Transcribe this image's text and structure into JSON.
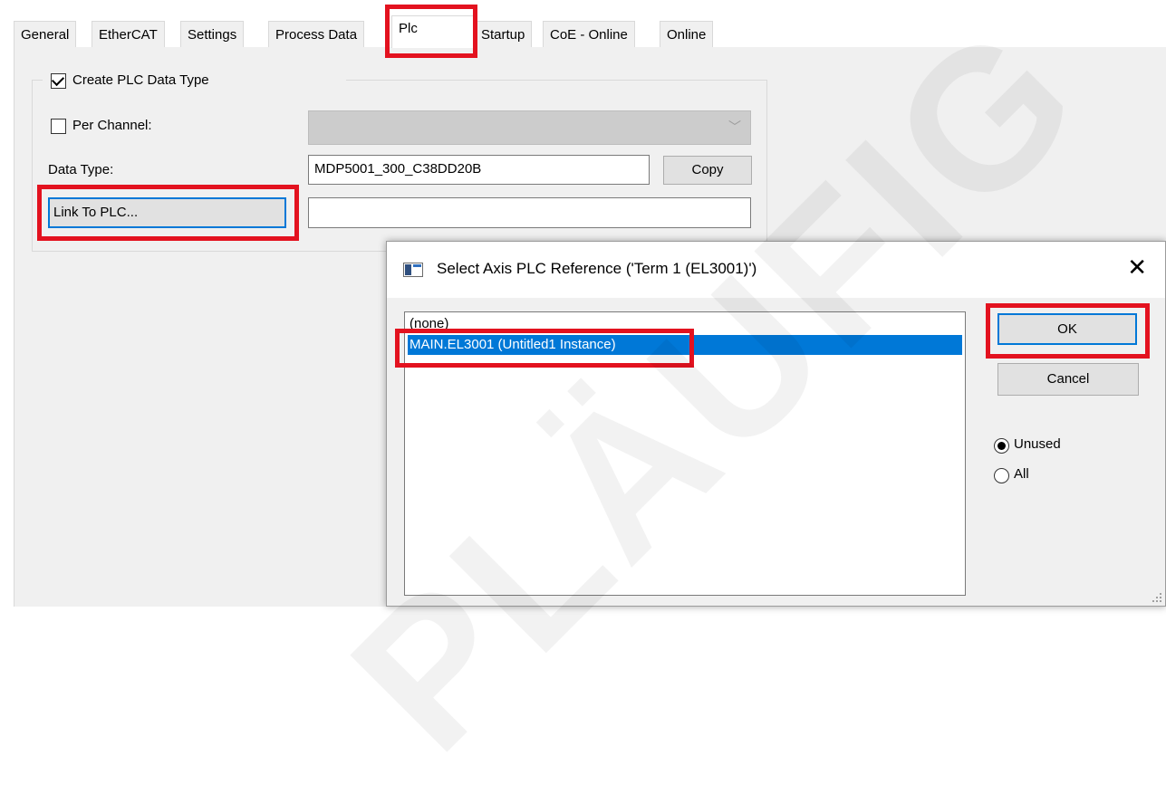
{
  "tabs": [
    "General",
    "EtherCAT",
    "Settings",
    "Process Data",
    "Plc",
    "Startup",
    "CoE - Online",
    "Online"
  ],
  "active_tab": "Plc",
  "plc": {
    "create_plc_data_type_label": "Create PLC Data Type",
    "create_plc_data_type_checked": true,
    "per_channel_label": "Per Channel:",
    "per_channel_checked": false,
    "per_channel_value": "",
    "data_type_label": "Data Type:",
    "data_type_value": "MDP5001_300_C38DD20B",
    "copy_button": "Copy",
    "link_to_plc_button": "Link To PLC...",
    "link_value": ""
  },
  "dialog": {
    "title": "Select Axis PLC Reference ('Term 1 (EL3001)')",
    "close_glyph": "✕",
    "items": [
      "(none)",
      "MAIN.EL3001 (Untitled1 Instance)"
    ],
    "selected_index": 1,
    "ok_button": "OK",
    "cancel_button": "Cancel",
    "radio_unused": "Unused",
    "radio_all": "All",
    "radio_selected": "Unused"
  },
  "watermark": "PLÄUFIG",
  "colors": {
    "highlight": "#e3121f",
    "selection": "#0078d7",
    "panel_bg": "#f0f0f0"
  }
}
